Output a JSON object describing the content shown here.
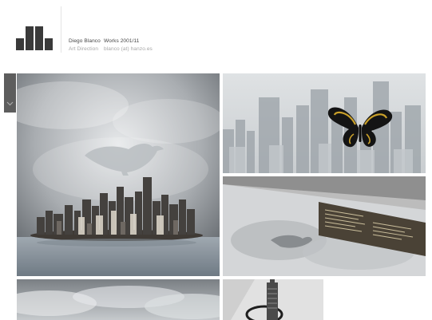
{
  "header": {
    "logo_icon": "bar-chart-logo-icon",
    "author": {
      "name": "Diego Blanco",
      "role": "Art Direction"
    },
    "works": {
      "title": "Works 2001/11",
      "email": "blanco (at) hanzo.es"
    }
  },
  "side_tab": {
    "icon": "chevron-down-icon"
  },
  "gallery": [
    {
      "name": "city-island-bird-thumbnail"
    },
    {
      "name": "butterfly-city-thumbnail"
    },
    {
      "name": "album-cover-thumbnail"
    },
    {
      "name": "clouds-thumbnail"
    },
    {
      "name": "tower-thumbnail"
    }
  ],
  "colors": {
    "logo": "#3a3a3a",
    "side_tab": "#5d5d5d",
    "text_dark": "#444444",
    "text_light": "#a6a6a6",
    "butterfly_wing": "#caa12a"
  }
}
